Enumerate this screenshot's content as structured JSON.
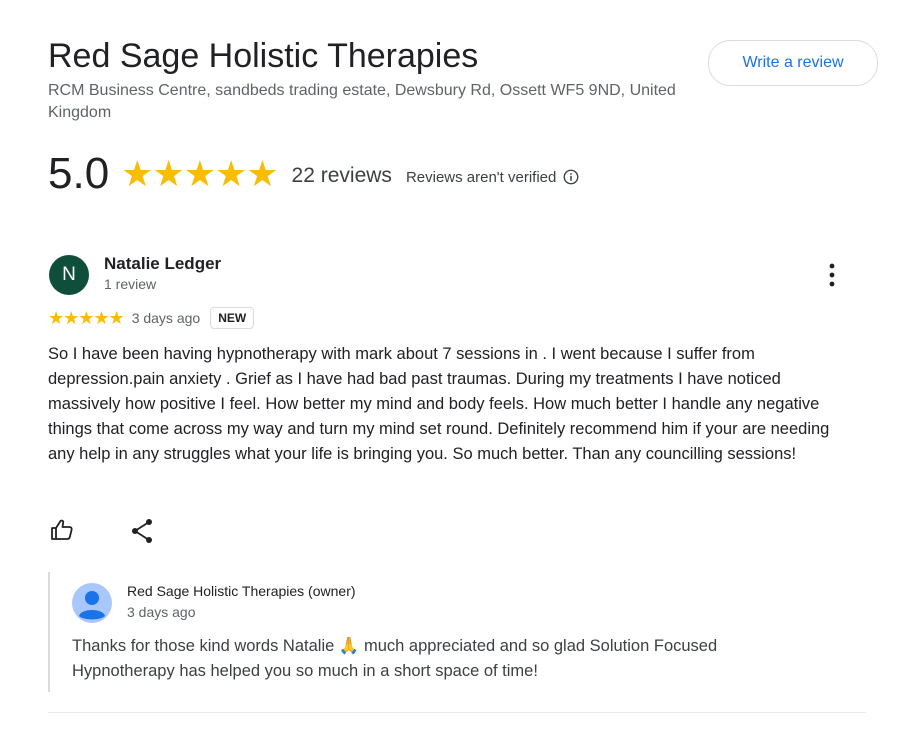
{
  "business": {
    "name": "Red Sage Holistic Therapies",
    "address": "RCM Business Centre, sandbeds trading estate, Dewsbury Rd, Ossett WF5 9ND, United Kingdom",
    "write_review_label": "Write a review"
  },
  "rating": {
    "score": "5.0",
    "stars": "★★★★★",
    "review_count": "22 reviews",
    "verification_note": "Reviews aren't verified"
  },
  "review": {
    "avatar_letter": "N",
    "reviewer_name": "Natalie Ledger",
    "reviewer_meta": "1 review",
    "stars": "★★★★★",
    "date": "3 days ago",
    "badge": "NEW",
    "text": "So I have been having hypnotherapy with mark about 7 sessions in . I went because I suffer from depression.pain anxiety . Grief as I have had bad past traumas. During my treatments I have noticed massively how positive I feel. How better my mind and body feels. How much better I handle any negative things that come across my way and turn my mind set round. Definitely recommend him if your are needing any help in any struggles what your life is bringing you. So much better. Than any councilling sessions!"
  },
  "owner_reply": {
    "name": "Red Sage Holistic Therapies (owner)",
    "date": "3 days ago",
    "text": "Thanks for those kind words Natalie 🙏 much appreciated and so glad Solution Focused Hypnotherapy has helped you so much in a short space of time!"
  },
  "icons": {
    "info": "info-icon",
    "more": "more-vert-icon",
    "like": "thumbs-up-icon",
    "share": "share-icon",
    "owner_avatar": "person-avatar-icon"
  },
  "colors": {
    "star": "#fbbc04",
    "link": "#1a73e8",
    "avatar_bg": "#0f4e3a",
    "owner_avatar_bg": "#a8c7fa",
    "owner_avatar_fg": "#1a73e8"
  }
}
